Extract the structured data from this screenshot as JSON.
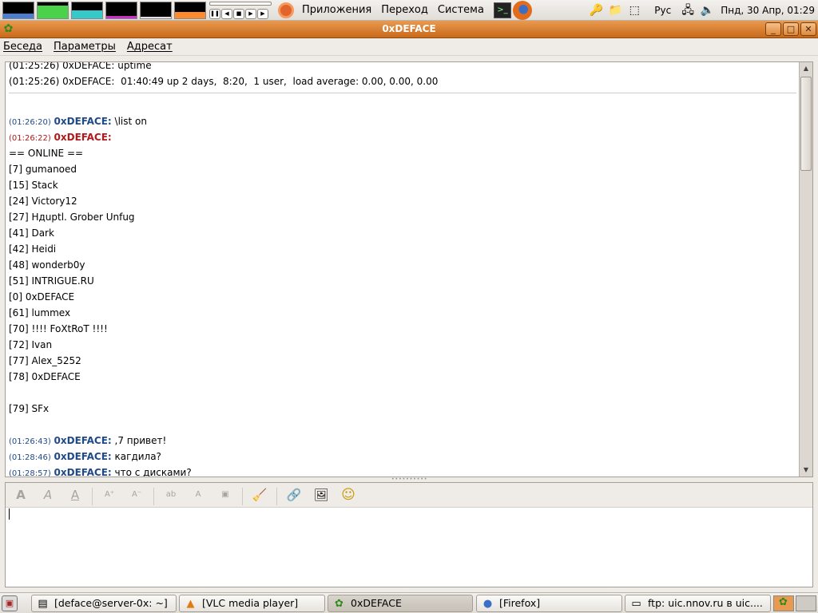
{
  "top_panel": {
    "menus": [
      "Приложения",
      "Переход",
      "Система"
    ],
    "language": "Рус",
    "clock": "Пнд, 30 Апр, 01:29"
  },
  "window": {
    "title": "0xDEFACE"
  },
  "menubar": [
    "Беседа",
    "Параметры",
    "Адресат"
  ],
  "chat": {
    "partial_top": "(01:25:26) 0xDEFACE: uptime",
    "system_line": "(01:25:26) 0xDEFACE:  01:40:49 up 2 days,  8:20,  1 user,  load average: 0.00, 0.00, 0.00",
    "messages": [
      {
        "ts": "(01:26:20)",
        "nick": "0xDEFACE:",
        "text": " \\list on",
        "kind": "me"
      },
      {
        "ts": "(01:26:22)",
        "nick": "0xDEFACE:",
        "text": "",
        "kind": "peer"
      }
    ],
    "list_lines": [
      "== ONLINE ==",
      "[7] gumanoed",
      "[15] Stack",
      "[24] Victory12",
      "[27] Hдuptl. Grober Unfug",
      "[41] Dark",
      "[42] Heidi",
      "[48] wonderb0y",
      "[51] INTRIGUE.RU",
      "[0] 0xDEFACE",
      "[61] lummex",
      "[70] !!!! FoXtRoT !!!!",
      "[72] Ivan",
      "[77] Alex_5252",
      "[78] 0xDEFACE",
      "",
      "[79] SFx",
      ""
    ],
    "later_messages": [
      {
        "ts": "(01:26:43)",
        "nick": "0xDEFACE:",
        "text": " ,7 привет!",
        "kind": "me"
      },
      {
        "ts": "(01:28:46)",
        "nick": "0xDEFACE:",
        "text": " кагдила?",
        "kind": "me"
      },
      {
        "ts": "(01:28:57)",
        "nick": "0xDEFACE:",
        "text": " что с дисками?",
        "kind": "me"
      }
    ]
  },
  "taskbar": [
    {
      "label": "[deface@server-0x: ~]",
      "icon": "terminal-icon"
    },
    {
      "label": "[VLC media player]",
      "icon": "vlc-icon"
    },
    {
      "label": "0xDEFACE",
      "icon": "pidgin-icon",
      "active": true
    },
    {
      "label": "[Firefox]",
      "icon": "globe-icon"
    },
    {
      "label": "ftp: uic.nnov.ru в uic....",
      "icon": "folder-icon"
    }
  ],
  "colors": {
    "titlebar": "#c9691a",
    "own_nick": "#204a87",
    "peer_nick": "#b11a1a"
  }
}
